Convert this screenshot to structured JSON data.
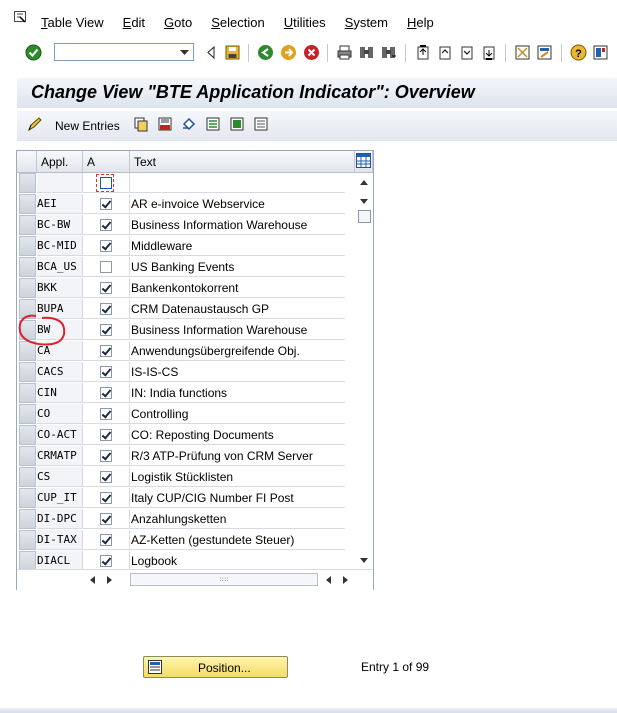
{
  "menu": {
    "items": [
      "Table View",
      "Edit",
      "Goto",
      "Selection",
      "Utilities",
      "System",
      "Help"
    ]
  },
  "toolbar": {
    "command_value": ""
  },
  "screen": {
    "title": "Change View \"BTE Application Indicator\": Overview"
  },
  "app_toolbar": {
    "new_entries_label": "New Entries"
  },
  "table": {
    "columns": [
      "Appl.",
      "A",
      "Text"
    ],
    "rows": [
      {
        "appl": "AEI",
        "active": true,
        "text": "AR e-invoice Webservice"
      },
      {
        "appl": "BC-BW",
        "active": true,
        "text": "Business Information Warehouse"
      },
      {
        "appl": "BC-MID",
        "active": true,
        "text": "Middleware"
      },
      {
        "appl": "BCA_US",
        "active": false,
        "text": "US Banking Events"
      },
      {
        "appl": "BKK",
        "active": true,
        "text": "Bankenkontokorrent"
      },
      {
        "appl": "BUPA",
        "active": true,
        "text": "CRM Datenaustausch GP"
      },
      {
        "appl": "BW",
        "active": true,
        "text": "Business Information Warehouse"
      },
      {
        "appl": "CA",
        "active": true,
        "text": "Anwendungsübergreifende Obj."
      },
      {
        "appl": "CACS",
        "active": true,
        "text": "IS-IS-CS"
      },
      {
        "appl": "CIN",
        "active": true,
        "text": "IN: India functions"
      },
      {
        "appl": "CO",
        "active": true,
        "text": "Controlling"
      },
      {
        "appl": "CO-ACT",
        "active": true,
        "text": "CO: Reposting Documents"
      },
      {
        "appl": "CRMATP",
        "active": true,
        "text": "R/3 ATP-Prüfung von CRM Server"
      },
      {
        "appl": "CS",
        "active": true,
        "text": "Logistik Stücklisten"
      },
      {
        "appl": "CUP_IT",
        "active": true,
        "text": "Italy CUP/CIG Number FI Post"
      },
      {
        "appl": "DI-DPC",
        "active": true,
        "text": "Anzahlungsketten"
      },
      {
        "appl": "DI-TAX",
        "active": true,
        "text": "AZ-Ketten (gestundete Steuer)"
      },
      {
        "appl": "DIACL",
        "active": true,
        "text": "Logbook"
      }
    ]
  },
  "footer": {
    "position_label": "Position...",
    "entry_info": "Entry 1 of 99"
  },
  "colors": {
    "annotation": "#e0202a",
    "title_bg": "#dde4ee",
    "position_button": "#f4dc63"
  }
}
